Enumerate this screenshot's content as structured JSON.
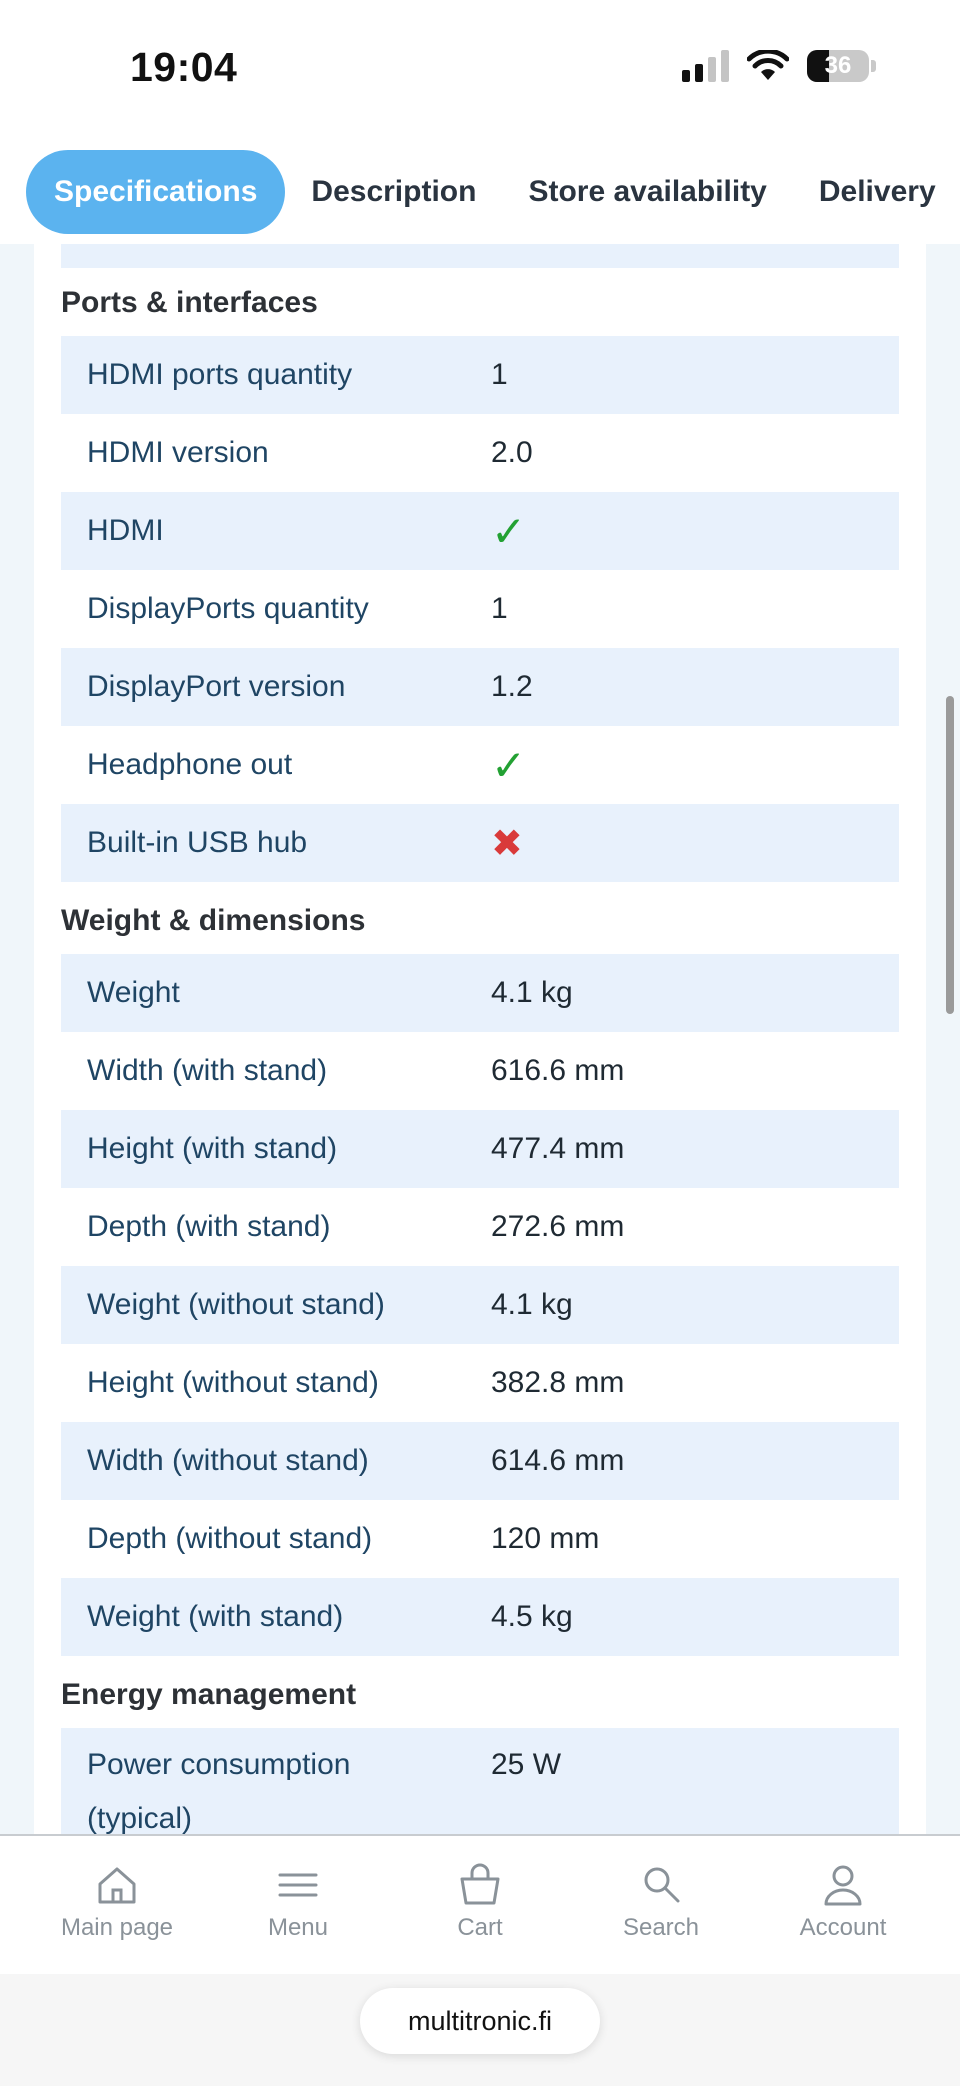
{
  "status": {
    "time": "19:04",
    "battery": "36"
  },
  "tabs": [
    "Specifications",
    "Description",
    "Store availability",
    "Delivery"
  ],
  "sections": {
    "ports": {
      "title": "Ports & interfaces",
      "rows": [
        {
          "label": "HDMI ports quantity",
          "value": "1"
        },
        {
          "label": "HDMI version",
          "value": "2.0"
        },
        {
          "label": "HDMI",
          "value": "✓"
        },
        {
          "label": "DisplayPorts quantity",
          "value": "1"
        },
        {
          "label": "DisplayPort version",
          "value": "1.2"
        },
        {
          "label": "Headphone out",
          "value": "✓"
        },
        {
          "label": "Built-in USB hub",
          "value": "✖"
        }
      ]
    },
    "weight": {
      "title": "Weight & dimensions",
      "rows": [
        {
          "label": "Weight",
          "value": "4.1 kg"
        },
        {
          "label": "Width (with stand)",
          "value": "616.6 mm"
        },
        {
          "label": "Height (with stand)",
          "value": "477.4 mm"
        },
        {
          "label": "Depth (with stand)",
          "value": "272.6 mm"
        },
        {
          "label": "Weight (without stand)",
          "value": "4.1 kg"
        },
        {
          "label": "Height (without stand)",
          "value": "382.8 mm"
        },
        {
          "label": "Width (without stand)",
          "value": "614.6 mm"
        },
        {
          "label": "Depth (without stand)",
          "value": "120 mm"
        },
        {
          "label": "Weight (with stand)",
          "value": "4.5 kg"
        }
      ]
    },
    "energy": {
      "title": "Energy management",
      "rows": [
        {
          "label": "Power consumption",
          "label2": "(typical)",
          "value": "25 W"
        }
      ]
    }
  },
  "nav": [
    "Main page",
    "Menu",
    "Cart",
    "Search",
    "Account"
  ],
  "url": "multitronic.fi",
  "colors": {
    "accent": "#5bb3ef",
    "row_shade": "#e8f1fc",
    "check": "#23a133",
    "cross": "#d93a3a"
  }
}
